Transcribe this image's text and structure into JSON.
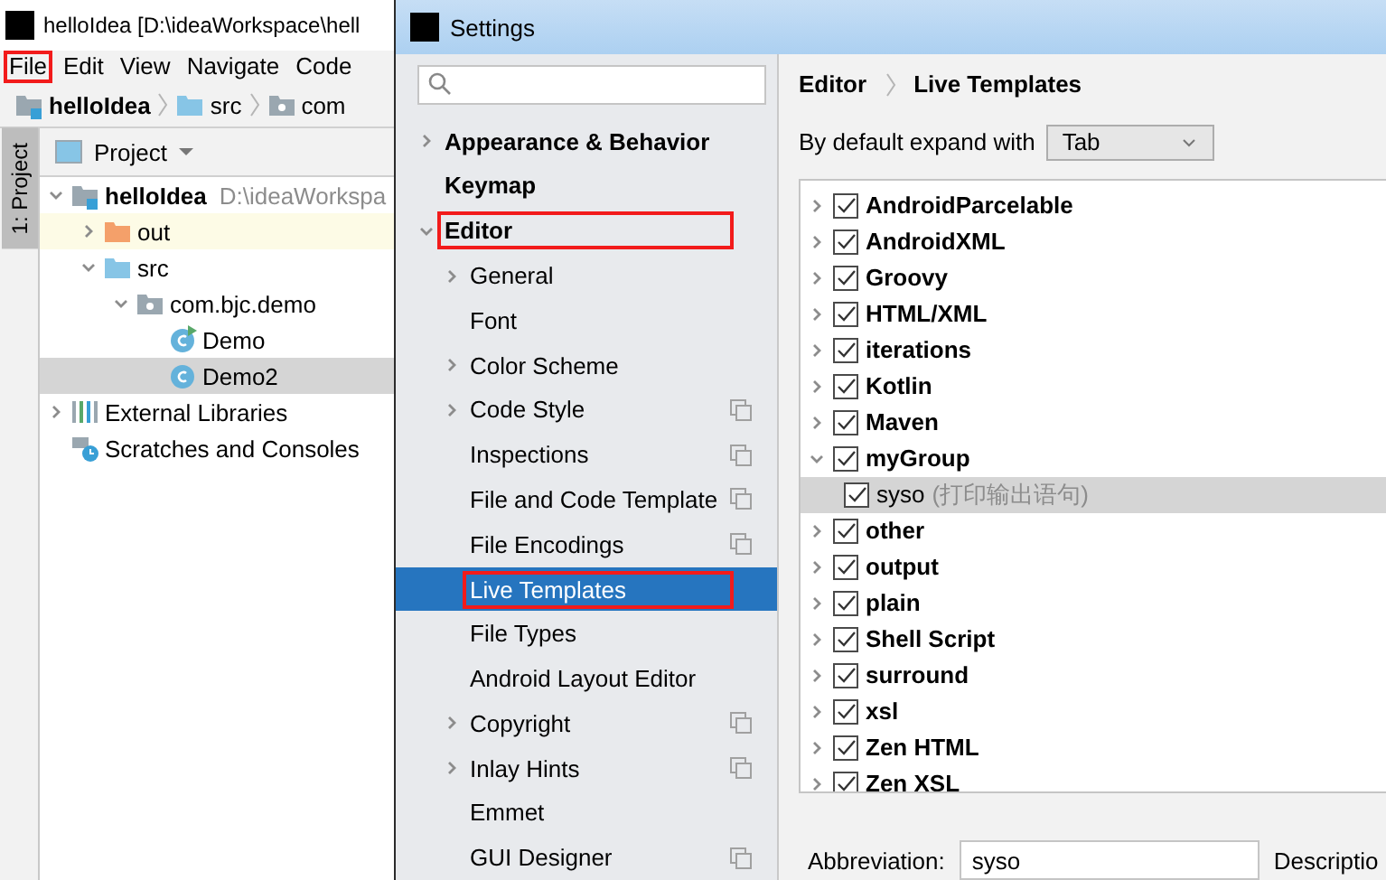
{
  "ide": {
    "title": "helloIdea [D:\\ideaWorkspace\\hell",
    "menu": [
      {
        "label": "File",
        "highlighted": true
      },
      {
        "label": "Edit",
        "highlighted": false
      },
      {
        "label": "View",
        "highlighted": false
      },
      {
        "label": "Navigate",
        "highlighted": false
      },
      {
        "label": "Code",
        "highlighted": false
      }
    ],
    "breadcrumb": [
      {
        "label": "helloIdea",
        "kind": "module",
        "bold": true
      },
      {
        "label": "src",
        "kind": "folder-blue",
        "bold": false
      },
      {
        "label": "com",
        "kind": "package",
        "bold": false
      }
    ],
    "side_tab": "1: Project",
    "panel_title": "Project",
    "tree": [
      {
        "label": "helloIdea",
        "note": "D:\\ideaWorkspa",
        "kind": "module",
        "bold": true,
        "expanded": true,
        "selected": false,
        "children": [
          {
            "label": "out",
            "kind": "folder-orange",
            "bold": false,
            "expanded": false,
            "selected": false,
            "excluded": true
          },
          {
            "label": "src",
            "kind": "folder-blue",
            "bold": false,
            "expanded": true,
            "selected": false,
            "children": [
              {
                "label": "com.bjc.demo",
                "kind": "package",
                "bold": false,
                "expanded": true,
                "selected": false,
                "children": [
                  {
                    "label": "Demo",
                    "kind": "class-run",
                    "bold": false,
                    "selected": false
                  },
                  {
                    "label": "Demo2",
                    "kind": "class",
                    "bold": false,
                    "selected": true
                  }
                ]
              }
            ]
          }
        ]
      },
      {
        "label": "External Libraries",
        "kind": "libraries",
        "bold": false,
        "expanded": false,
        "selected": false
      },
      {
        "label": "Scratches and Consoles",
        "kind": "scratches",
        "bold": false,
        "selected": false
      }
    ]
  },
  "settings": {
    "title": "Settings",
    "nav": [
      {
        "label": "Appearance & Behavior",
        "kind": "section",
        "expanded": false,
        "scoped": false,
        "selected": false,
        "highlighted": false
      },
      {
        "label": "Keymap",
        "kind": "section",
        "scoped": false,
        "selected": false,
        "highlighted": false
      },
      {
        "label": "Editor",
        "kind": "section",
        "expanded": true,
        "scoped": false,
        "selected": false,
        "highlighted": true,
        "children": [
          {
            "label": "General",
            "kind": "item",
            "expanded": false,
            "scoped": false,
            "selected": false,
            "highlighted": false
          },
          {
            "label": "Font",
            "kind": "item",
            "scoped": false,
            "selected": false,
            "highlighted": false
          },
          {
            "label": "Color Scheme",
            "kind": "item",
            "expanded": false,
            "scoped": false,
            "selected": false,
            "highlighted": false
          },
          {
            "label": "Code Style",
            "kind": "item",
            "expanded": false,
            "scoped": true,
            "selected": false,
            "highlighted": false
          },
          {
            "label": "Inspections",
            "kind": "item",
            "scoped": true,
            "selected": false,
            "highlighted": false
          },
          {
            "label": "File and Code Template",
            "kind": "item",
            "scoped": true,
            "selected": false,
            "highlighted": false
          },
          {
            "label": "File Encodings",
            "kind": "item",
            "scoped": true,
            "selected": false,
            "highlighted": false
          },
          {
            "label": "Live Templates",
            "kind": "item",
            "scoped": false,
            "selected": true,
            "highlighted": true
          },
          {
            "label": "File Types",
            "kind": "item",
            "scoped": false,
            "selected": false,
            "highlighted": false
          },
          {
            "label": "Android Layout Editor",
            "kind": "item",
            "scoped": false,
            "selected": false,
            "highlighted": false
          },
          {
            "label": "Copyright",
            "kind": "item",
            "expanded": false,
            "scoped": true,
            "selected": false,
            "highlighted": false
          },
          {
            "label": "Inlay Hints",
            "kind": "item",
            "expanded": false,
            "scoped": true,
            "selected": false,
            "highlighted": false
          },
          {
            "label": "Emmet",
            "kind": "item",
            "scoped": false,
            "selected": false,
            "highlighted": false
          },
          {
            "label": "GUI Designer",
            "kind": "item",
            "scoped": true,
            "selected": false,
            "highlighted": false
          }
        ]
      }
    ],
    "breadcrumb": [
      "Editor",
      "Live Templates"
    ],
    "expand_label": "By default expand with",
    "expand_value": "Tab",
    "templates": [
      {
        "label": "AndroidParcelable",
        "checked": true,
        "expanded": false
      },
      {
        "label": "AndroidXML",
        "checked": true,
        "expanded": false
      },
      {
        "label": "Groovy",
        "checked": true,
        "expanded": false
      },
      {
        "label": "HTML/XML",
        "checked": true,
        "expanded": false
      },
      {
        "label": "iterations",
        "checked": true,
        "expanded": false
      },
      {
        "label": "Kotlin",
        "checked": true,
        "expanded": false
      },
      {
        "label": "Maven",
        "checked": true,
        "expanded": false
      },
      {
        "label": "myGroup",
        "checked": true,
        "expanded": true,
        "children": [
          {
            "label": "syso",
            "description": "(打印输出语句)",
            "checked": true,
            "selected": true
          }
        ]
      },
      {
        "label": "other",
        "checked": true,
        "expanded": false
      },
      {
        "label": "output",
        "checked": true,
        "expanded": false
      },
      {
        "label": "plain",
        "checked": true,
        "expanded": false
      },
      {
        "label": "Shell Script",
        "checked": true,
        "expanded": false
      },
      {
        "label": "surround",
        "checked": true,
        "expanded": false
      },
      {
        "label": "xsl",
        "checked": true,
        "expanded": false
      },
      {
        "label": "Zen HTML",
        "checked": true,
        "expanded": false
      },
      {
        "label": "Zen XSL",
        "checked": true,
        "expanded": false
      }
    ],
    "abbreviation_label": "Abbreviation:",
    "abbreviation_value": "syso",
    "description_label": "Descriptio"
  }
}
